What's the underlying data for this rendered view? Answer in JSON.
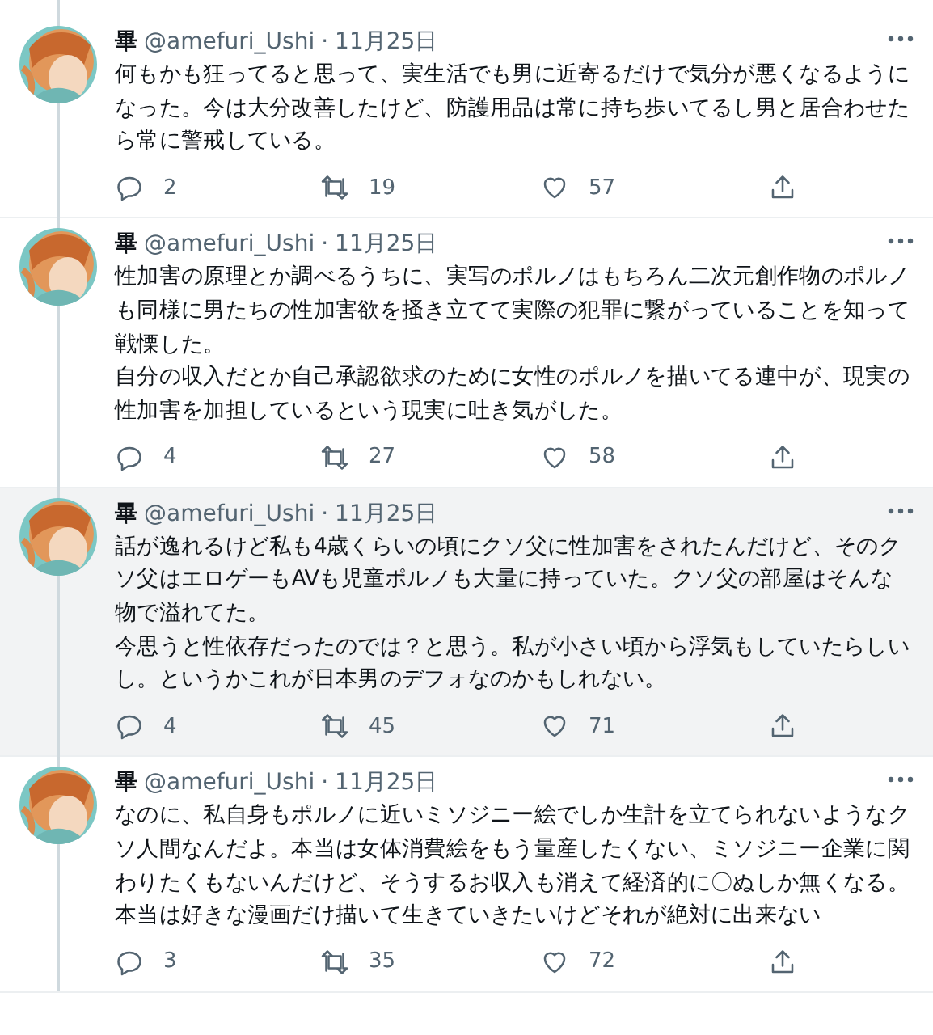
{
  "tweets": [
    {
      "name": "畢",
      "handle": "@amefuri_Ushi",
      "separator": "·",
      "date": "11月25日",
      "highlighted": false,
      "paragraphs": [
        "何もかも狂ってると思って、実生活でも男に近寄るだけで気分が悪くなるようになった。今は大分改善したけど、防護用品は常に持ち歩いてるし男と居合わせたら常に警戒している。"
      ],
      "replies": "2",
      "retweets": "19",
      "likes": "57"
    },
    {
      "name": "畢",
      "handle": "@amefuri_Ushi",
      "separator": "·",
      "date": "11月25日",
      "highlighted": false,
      "paragraphs": [
        "性加害の原理とか調べるうちに、実写のポルノはもちろん二次元創作物のポルノも同様に男たちの性加害欲を掻き立てて実際の犯罪に繋がっていることを知って戦慄した。",
        "自分の収入だとか自己承認欲求のために女性のポルノを描いてる連中が、現実の性加害を加担しているという現実に吐き気がした。"
      ],
      "replies": "4",
      "retweets": "27",
      "likes": "58"
    },
    {
      "name": "畢",
      "handle": "@amefuri_Ushi",
      "separator": "·",
      "date": "11月25日",
      "highlighted": true,
      "paragraphs": [
        "話が逸れるけど私も4歳くらいの頃にクソ父に性加害をされたんだけど、そのクソ父はエロゲーもAVも児童ポルノも大量に持っていた。クソ父の部屋はそんな物で溢れてた。",
        "今思うと性依存だったのでは？と思う。私が小さい頃から浮気もしていたらしいし。というかこれが日本男のデフォなのかもしれない。"
      ],
      "replies": "4",
      "retweets": "45",
      "likes": "71"
    },
    {
      "name": "畢",
      "handle": "@amefuri_Ushi",
      "separator": "·",
      "date": "11月25日",
      "highlighted": false,
      "paragraphs": [
        "なのに、私自身もポルノに近いミソジニー絵でしか生計を立てられないようなクソ人間なんだよ。本当は女体消費絵をもう量産したくない、ミソジニー企業に関わりたくもないんだけど、そうするお収入も消えて経済的に〇ぬしか無くなる。",
        "本当は好きな漫画だけ描いて生きていきたいけどそれが絶対に出来ない"
      ],
      "replies": "3",
      "retweets": "35",
      "likes": "72"
    }
  ]
}
